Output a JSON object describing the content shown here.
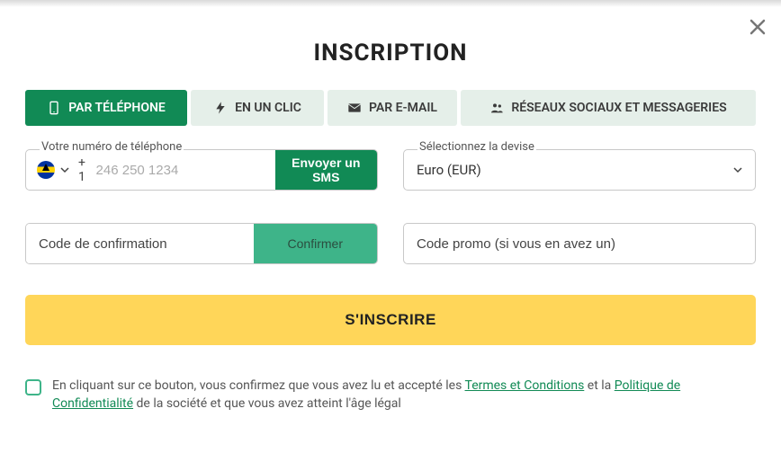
{
  "title": "INSCRIPTION",
  "tabs": {
    "phone": "PAR TÉLÉPHONE",
    "oneclick": "EN UN CLIC",
    "email": "PAR E-MAIL",
    "social": "RÉSEAUX SOCIAUX ET MESSAGERIES"
  },
  "phone_field": {
    "label": "Votre numéro de téléphone",
    "prefix": "+ 1",
    "placeholder": "246 250 1234",
    "sms_btn": "Envoyer un SMS"
  },
  "currency": {
    "label": "Sélectionnez la devise",
    "value": "Euro (EUR)"
  },
  "confirm": {
    "placeholder": "Code de confirmation",
    "btn": "Confirmer"
  },
  "promo": {
    "placeholder": "Code promo (si vous en avez un)"
  },
  "submit": "S'INSCRIRE",
  "terms": {
    "pre": "En cliquant sur ce bouton, vous confirmez que vous avez lu et accepté les ",
    "link1": "Termes et Conditions",
    "mid": " et la ",
    "link2": "Politique de Confidentialité",
    "post": " de la société et que vous avez atteint l'âge légal"
  }
}
